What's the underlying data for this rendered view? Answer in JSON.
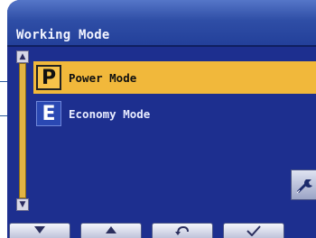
{
  "screen": {
    "title": "Working Mode"
  },
  "modes": [
    {
      "badge": "P",
      "label": "Power Mode",
      "selected": true
    },
    {
      "badge": "E",
      "label": "Economy Mode",
      "selected": false
    }
  ],
  "scrollbar": {
    "up_glyph": "▲",
    "down_glyph": "▼"
  },
  "softkeys": [
    {
      "icon": "down-arrow-icon"
    },
    {
      "icon": "up-arrow-icon"
    },
    {
      "icon": "return-icon"
    },
    {
      "icon": "checkmark-icon"
    }
  ],
  "colors": {
    "screen_bg": "#1d2f8f",
    "title_bar": "#2f4ea6",
    "selected_row": "#f1b83b"
  }
}
